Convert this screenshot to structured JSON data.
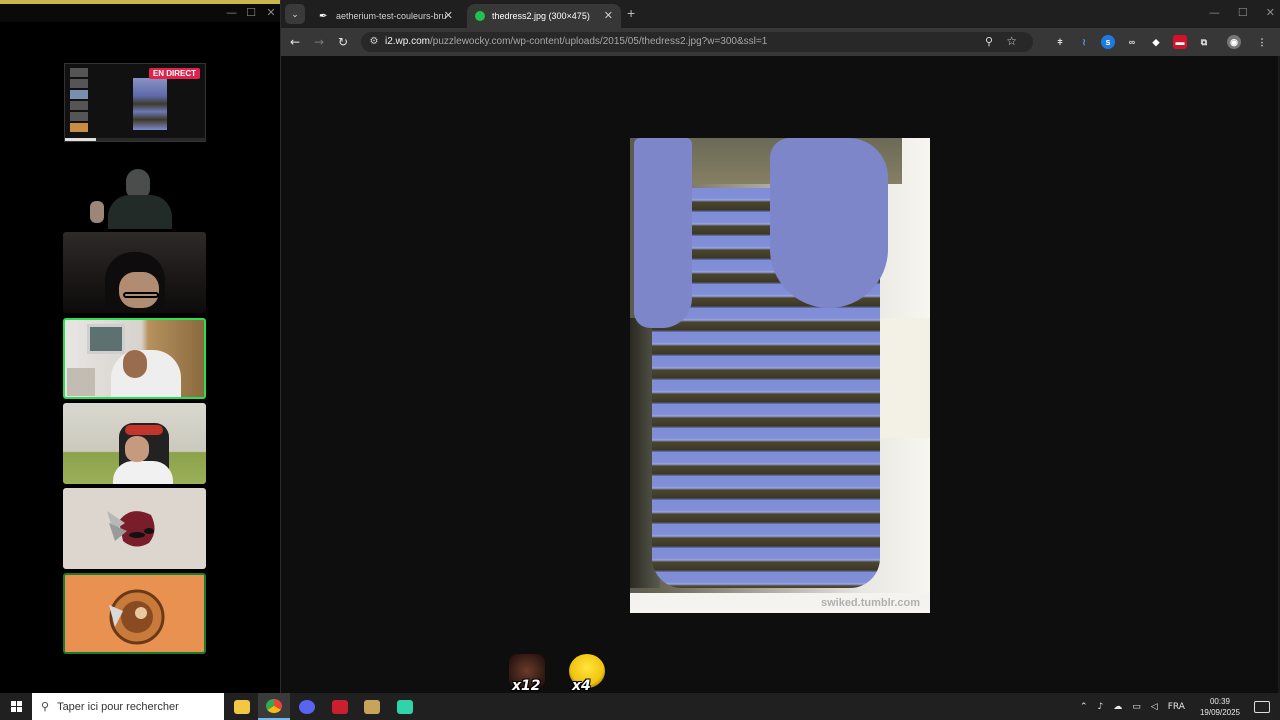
{
  "stream_panel": {
    "live_badge": "EN DIRECT",
    "cameras": [
      "cam-1",
      "cam-2",
      "cam-3",
      "cam-4",
      "cam-5"
    ]
  },
  "browser": {
    "tabs": [
      {
        "title": "aetherium-test-couleurs-brunu",
        "active": false
      },
      {
        "title": "thedress2.jpg (300×475)",
        "active": true
      }
    ],
    "url_host": "i2.wp.com",
    "url_path": "/puzzlewocky.com/wp-content/uploads/2015/05/thedress2.jpg?w=300&ssl=1",
    "image_caption": "swiked.tumblr.com",
    "emotes": [
      {
        "count": "x12",
        "color": "#5a2f22"
      },
      {
        "count": "x4",
        "color": "#f1c40f"
      }
    ]
  },
  "taskbar": {
    "search_placeholder": "Taper ici pour rechercher",
    "language": "FRA",
    "time": "00:39",
    "date": "19/09/2025"
  },
  "colors": {
    "active_tab_favicon": "#21c24d",
    "live_badge": "#e0234a",
    "active_cam_border": "#29e04f"
  }
}
